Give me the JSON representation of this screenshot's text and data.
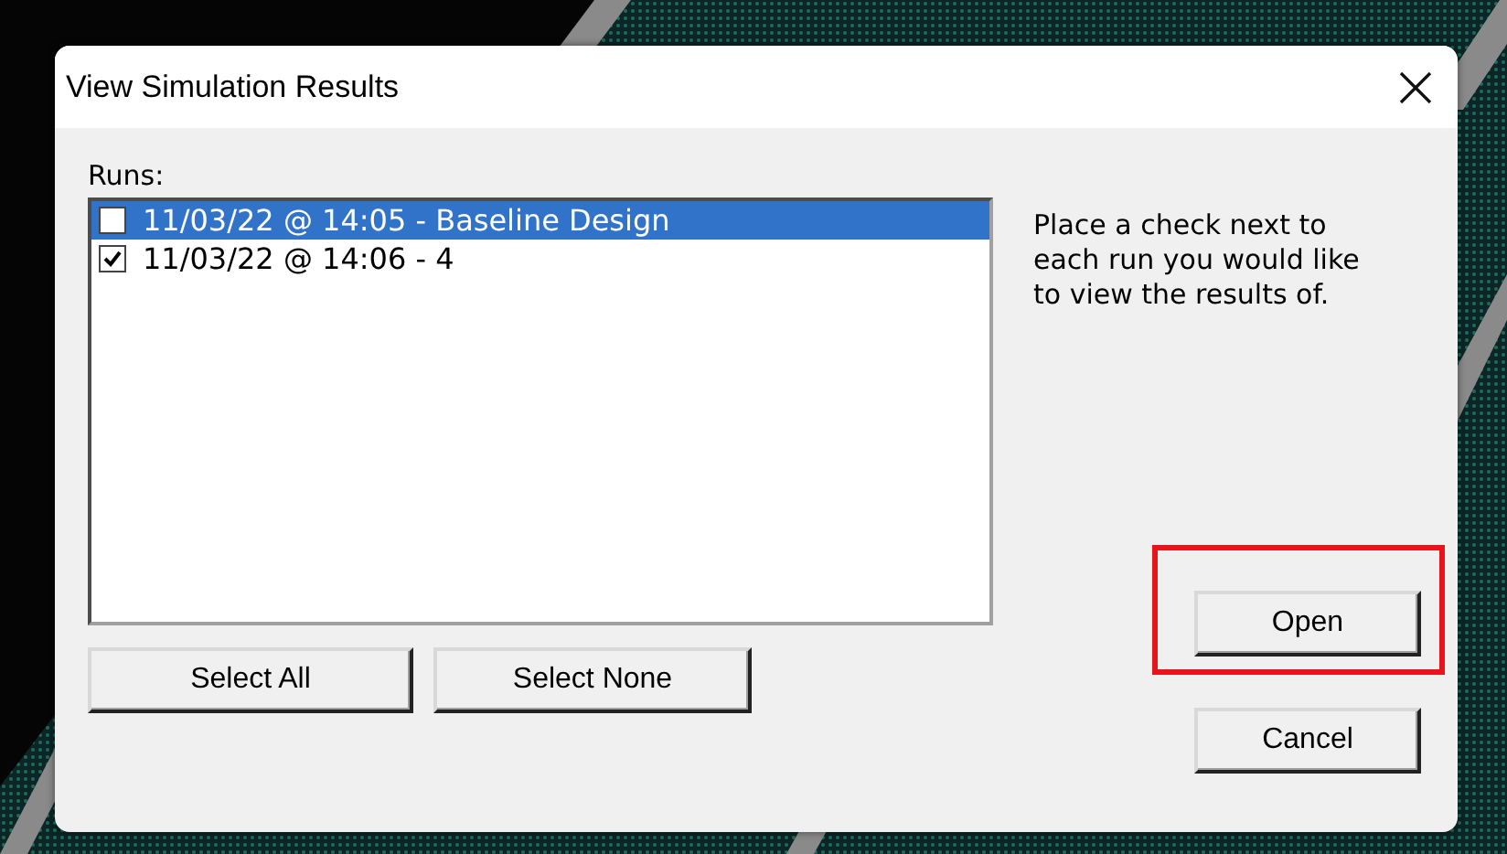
{
  "window": {
    "title": "View Simulation Results"
  },
  "runs": {
    "label": "Runs:",
    "items": [
      {
        "text": "11/03/22 @ 14:05 - Baseline Design",
        "checked": false,
        "selected": true
      },
      {
        "text": "11/03/22 @ 14:06 - 4",
        "checked": true,
        "selected": false
      }
    ]
  },
  "instructions": "Place a check next to each run you would like to view the results of.",
  "list_buttons": [
    {
      "label": "Select All"
    },
    {
      "label": "Select None"
    }
  ],
  "action_buttons": [
    {
      "label": "Open",
      "highlighted": true
    },
    {
      "label": "Cancel",
      "highlighted": false
    }
  ]
}
